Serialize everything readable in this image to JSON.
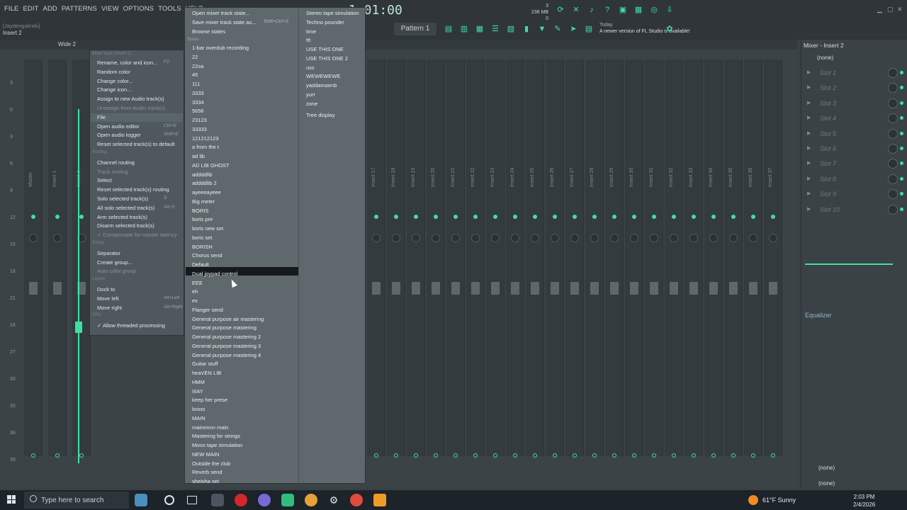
{
  "menubar": {
    "items": [
      "FILE",
      "EDIT",
      "ADD",
      "PATTERNS",
      "VIEW",
      "OPTIONS",
      "TOOLS",
      "HELP"
    ]
  },
  "header": {
    "user": "[Jaydengalindo]",
    "insert_label": "Insert 2",
    "time": "1:01:00",
    "cpu_top": "3",
    "memory": "238 MB",
    "cpu_bottom": "0",
    "pattern": "Pattern 1",
    "news_date": "Today",
    "news_text": "A newer version of FL Studio is available!"
  },
  "mixer": {
    "view_label": "Wide 2",
    "scale": [
      "3",
      "0",
      "3",
      "6",
      "9",
      "12",
      "15",
      "18",
      "21",
      "24",
      "27",
      "30",
      "33",
      "36",
      "39"
    ],
    "strip_names": [
      "Master",
      "Insert 1",
      "Insert 2",
      "Insert 17",
      "Insert 18",
      "Insert 19",
      "Insert 20",
      "Insert 21",
      "Insert 22",
      "Insert 23",
      "Insert 24",
      "Insert 25",
      "Insert 26",
      "Insert 27",
      "Insert 28",
      "Insert 29",
      "Insert 30",
      "Insert 31",
      "Insert 32",
      "Insert 33",
      "Insert 34",
      "Insert 35",
      "Insert 36",
      "Insert 37",
      "Insert 38",
      "Insert 39"
    ]
  },
  "right_panel": {
    "title": "Mixer - Insert 2",
    "input": "(none)",
    "slots": [
      "Slot 1",
      "Slot 2",
      "Slot 3",
      "Slot 4",
      "Slot 5",
      "Slot 6",
      "Slot 7",
      "Slot 8",
      "Slot 9",
      "Slot 10"
    ],
    "eq_label": "Equalizer",
    "output1": "(none)",
    "output2": "(none)"
  },
  "context_menu": {
    "header": "Mixer track (Insert 2)",
    "items": [
      {
        "label": "Rename, color and icon...",
        "shortcut": "F2"
      },
      {
        "label": "Random color"
      },
      {
        "label": "Change color..."
      },
      {
        "label": "Change icon..."
      },
      {
        "label": "Assign to new Audio track(s)"
      },
      {
        "label": "Unassign from Audio track(s)",
        "disabled": true
      },
      {
        "label": "File",
        "highlight": true
      },
      {
        "label": "Open audio editor",
        "shortcut": "Ctrl+E"
      },
      {
        "label": "Open audio logger",
        "shortcut": "Shift+E"
      },
      {
        "label": "Reset selected track(s) to default"
      },
      {
        "label": "Routing",
        "header": true
      },
      {
        "label": "Channel routing"
      },
      {
        "label": "Track routing",
        "disabled": true
      },
      {
        "label": "Select"
      },
      {
        "label": "Reset selected track(s) routing"
      },
      {
        "label": "Solo selected track(s)",
        "shortcut": "S"
      },
      {
        "label": "All solo selected track(s)",
        "shortcut": "Alt+S"
      },
      {
        "label": "Arm selected track(s)"
      },
      {
        "label": "Disarm selected track(s)"
      },
      {
        "label": "✓ Compensate for master latency",
        "disabled": true
      },
      {
        "label": "Group",
        "header": true
      },
      {
        "label": "Separator"
      },
      {
        "label": "Create group..."
      },
      {
        "label": "Auto color group",
        "disabled": true
      },
      {
        "label": "Layout",
        "header": true
      },
      {
        "label": "Dock to"
      },
      {
        "label": "Move left",
        "shortcut": "Alt+Left"
      },
      {
        "label": "Move right",
        "shortcut": "Alt+Right"
      },
      {
        "label": "CPU",
        "header": true
      },
      {
        "label": "✓ Allow threaded processing"
      }
    ]
  },
  "preset_menu": {
    "top_items": [
      {
        "label": "Open mixer track state..."
      },
      {
        "label": "Save mixer track state as...",
        "shortcut": "Shift+Ctrl+S"
      },
      {
        "label": "Browse states"
      }
    ],
    "section_label": "States",
    "col1": [
      "1-bar overdub recording",
      "22",
      "22sa",
      "45",
      "111",
      "3333",
      "3334",
      "5656",
      "23123",
      "33333",
      "121212123",
      "a from the t",
      "ad lib",
      "AD LIB GHOST",
      "addddlib",
      "addddlib 2",
      "ayeeeayeee",
      "Big meter",
      "BORIS",
      "boris pre",
      "boris new set",
      "boris set",
      "BORISH",
      "Chorus send",
      "Default",
      "Dual joypad control",
      "EEE",
      "eh",
      "ex",
      "Flanger send",
      "General purpose air mastering",
      "General purpose mastering",
      "General purpose mastering 2",
      "General purpose mastering 3",
      "General purpose mastering 4",
      "Guitar stuff",
      "heaVEN LIB",
      "HMM",
      "IIIAY",
      "keep her prese",
      "loooo",
      "MAIN",
      "mainnnnn main",
      "Mastering for strings",
      "Mono tape simulation",
      "NEW MAIN",
      "Outside the club",
      "Reverb send",
      "sheisha set"
    ],
    "col2": [
      "Stereo tape simulation",
      "Techno pounder",
      "time",
      "ttt",
      "USE THIS ONE",
      "USE THIS ONE 2",
      "uss",
      "WEWEWEWE",
      "yaddamaenb",
      "yurr",
      "zone",
      "Tree display"
    ]
  },
  "taskbar": {
    "search_placeholder": "Type here to search",
    "weather": "61°F  Sunny",
    "time": "2:03 PM",
    "date": "2/4/2026"
  },
  "colors": {
    "accent": "#3fe0a0",
    "menu_bg": "#5e686d",
    "highlight": "#161a1c"
  }
}
